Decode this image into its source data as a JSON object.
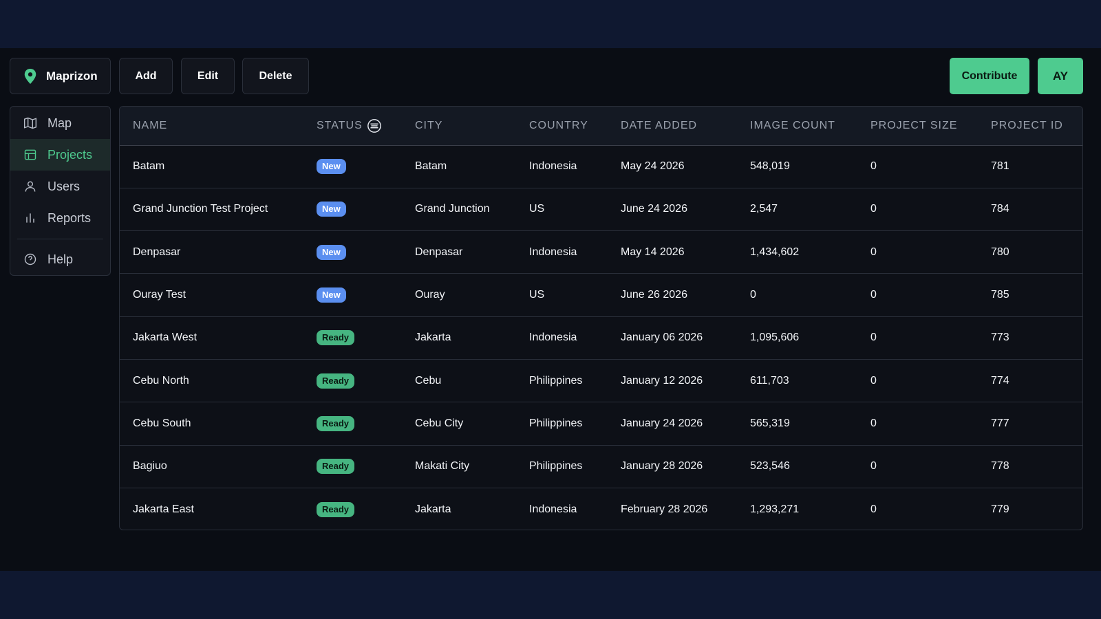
{
  "brand": {
    "name": "Maprizon",
    "icon": "map-pin-icon",
    "accent": "#4ecb8f"
  },
  "toolbar": {
    "add_label": "Add",
    "edit_label": "Edit",
    "delete_label": "Delete",
    "contribute_label": "Contribute",
    "avatar_initials": "AY"
  },
  "sidebar": {
    "items": [
      {
        "label": "Map",
        "icon": "map-icon",
        "active": false
      },
      {
        "label": "Projects",
        "icon": "table-icon",
        "active": true
      },
      {
        "label": "Users",
        "icon": "user-icon",
        "active": false
      },
      {
        "label": "Reports",
        "icon": "bar-chart-icon",
        "active": false
      },
      {
        "label": "Help",
        "icon": "help-circle-icon",
        "active": false
      }
    ]
  },
  "table": {
    "headers": {
      "name": "NAME",
      "status": "STATUS",
      "city": "CITY",
      "country": "COUNTRY",
      "date_added": "DATE ADDED",
      "image_count": "IMAGE COUNT",
      "project_size": "PROJECT SIZE",
      "project_id": "PROJECT ID"
    },
    "status_colors": {
      "New": "#5b8ff0",
      "Ready": "#46b581"
    },
    "rows": [
      {
        "name": "Batam",
        "status": "New",
        "city": "Batam",
        "country": "Indonesia",
        "date_added": "May 24 2026",
        "image_count": "548,019",
        "project_size": "0",
        "project_id": "781"
      },
      {
        "name": "Grand Junction Test Project",
        "status": "New",
        "city": "Grand Junction",
        "country": "US",
        "date_added": "June 24 2026",
        "image_count": "2,547",
        "project_size": "0",
        "project_id": "784"
      },
      {
        "name": "Denpasar",
        "status": "New",
        "city": "Denpasar",
        "country": "Indonesia",
        "date_added": "May 14 2026",
        "image_count": "1,434,602",
        "project_size": "0",
        "project_id": "780"
      },
      {
        "name": "Ouray Test",
        "status": "New",
        "city": "Ouray",
        "country": "US",
        "date_added": "June 26 2026",
        "image_count": "0",
        "project_size": "0",
        "project_id": "785"
      },
      {
        "name": "Jakarta West",
        "status": "Ready",
        "city": "Jakarta",
        "country": "Indonesia",
        "date_added": "January 06 2026",
        "image_count": "1,095,606",
        "project_size": "0",
        "project_id": "773"
      },
      {
        "name": "Cebu North",
        "status": "Ready",
        "city": "Cebu",
        "country": "Philippines",
        "date_added": "January 12 2026",
        "image_count": "611,703",
        "project_size": "0",
        "project_id": "774"
      },
      {
        "name": "Cebu South",
        "status": "Ready",
        "city": "Cebu City",
        "country": "Philippines",
        "date_added": "January 24 2026",
        "image_count": "565,319",
        "project_size": "0",
        "project_id": "777"
      },
      {
        "name": "Bagiuo",
        "status": "Ready",
        "city": "Makati City",
        "country": "Philippines",
        "date_added": "January 28 2026",
        "image_count": "523,546",
        "project_size": "0",
        "project_id": "778"
      },
      {
        "name": "Jakarta East",
        "status": "Ready",
        "city": "Jakarta",
        "country": "Indonesia",
        "date_added": "February 28 2026",
        "image_count": "1,293,271",
        "project_size": "0",
        "project_id": "779"
      }
    ]
  }
}
